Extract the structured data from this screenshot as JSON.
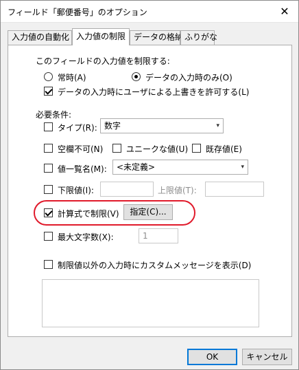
{
  "window": {
    "title": "フィールド「郵便番号」のオプション"
  },
  "tabs": [
    {
      "label": "入力値の自動化"
    },
    {
      "label": "入力値の制限"
    },
    {
      "label": "データの格納"
    },
    {
      "label": "ふりがな"
    }
  ],
  "restrict": {
    "heading": "このフィールドの入力値を制限する:",
    "always_label": "常時(A)",
    "data_entry_only_label": "データの入力時のみ(O)",
    "allow_override_label": "データの入力時にユーザによる上書きを許可する(L)"
  },
  "requirements": {
    "heading": "必要条件:",
    "type_label": "タイプ(R):",
    "type_value": "数字",
    "not_empty_label": "空欄不可(N)",
    "unique_label": "ユニークな値(U)",
    "existing_label": "既存値(E)",
    "value_list_label": "値一覧名(M):",
    "value_list_value": "<未定義>",
    "min_label": "下限値(I):",
    "max_label": "上限値(T):",
    "calc_label": "計算式で制限(V)",
    "specify_button": "指定(C)...",
    "max_chars_label": "最大文字数(X):",
    "max_chars_value": "1",
    "custom_message_label": "制限値以外の入力時にカスタムメッセージを表示(D)"
  },
  "footer": {
    "ok_label": "OK",
    "cancel_label": "キャンセル"
  }
}
